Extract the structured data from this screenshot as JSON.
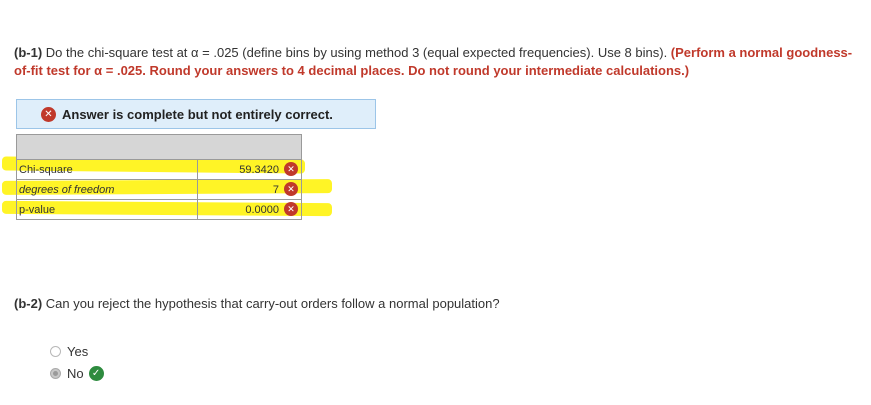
{
  "q1": {
    "label": "(b-1)",
    "text": " Do the chi-square test at α = .025 (define bins by using method 3 (equal expected frequencies). Use 8 bins). ",
    "instruction": "(Perform a normal goodness-of-fit test for α = .025. Round your answers to 4 decimal places. Do not round your intermediate calculations.)"
  },
  "banner": {
    "icon": "x-circle-icon",
    "text": "Answer is complete but not entirely correct."
  },
  "table": {
    "rows": [
      {
        "label": "Chi-square",
        "value": "59.3420",
        "status": "incorrect"
      },
      {
        "label": "degrees of freedom",
        "value": "7",
        "status": "incorrect"
      },
      {
        "label": "p-value",
        "value": "0.0000",
        "status": "incorrect"
      }
    ]
  },
  "q2": {
    "label": "(b-2)",
    "text": " Can you reject the hypothesis that carry-out orders follow a normal population?"
  },
  "options": [
    {
      "label": "Yes",
      "selected": false
    },
    {
      "label": "No",
      "selected": true,
      "status": "correct"
    }
  ],
  "colors": {
    "error": "#c0392b",
    "correct": "#2e8b3f",
    "highlight": "#fff200",
    "banner_bg": "#dfeefa"
  }
}
